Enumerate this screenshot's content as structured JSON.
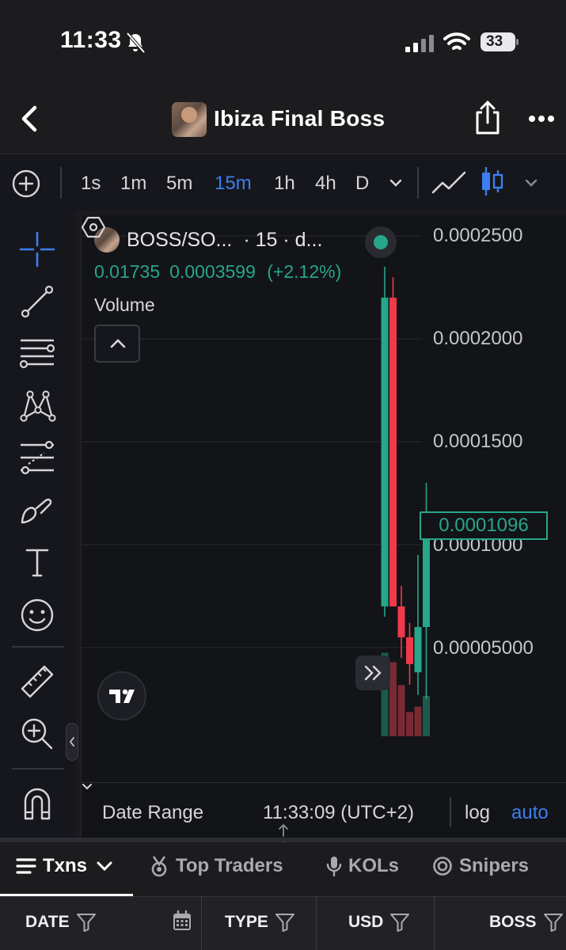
{
  "status_bar": {
    "time": "11:33",
    "battery": "33"
  },
  "header": {
    "title": "Ibiza Final Boss"
  },
  "timeframes": {
    "items": [
      "1s",
      "1m",
      "5m",
      "15m",
      "1h",
      "4h",
      "D"
    ],
    "active": "15m"
  },
  "chart": {
    "symbol": "BOSS/SO...",
    "interval": "· 15 · d...",
    "ohlc_change": "0.01735",
    "last_price": "0.0003599",
    "change_pct": "(+2.12%)",
    "volume_label": "Volume",
    "current_price_tag": "0.0001096",
    "date_range_label": "Date Range",
    "clock": "11:33:09 (UTC+2)",
    "log_label": "log",
    "auto_label": "auto",
    "colors": {
      "up": "#26a68a",
      "down": "#f0394a",
      "accent": "#3c7ef0"
    }
  },
  "chart_data": {
    "type": "candlestick",
    "y_ticks": [
      "0.0002500",
      "0.0002000",
      "0.0001500",
      "0.0001000",
      "0.00005000"
    ],
    "ylim": [
      0,
      0.00025
    ],
    "candles": [
      {
        "open": 7e-05,
        "high": 0.000235,
        "low": 6.5e-05,
        "close": 0.00022
      },
      {
        "open": 0.00022,
        "high": 0.00023,
        "low": 7e-05,
        "close": 7e-05
      },
      {
        "open": 7e-05,
        "high": 8e-05,
        "low": 4.5e-05,
        "close": 5.5e-05
      },
      {
        "open": 5.5e-05,
        "high": 6.2e-05,
        "low": 3.2e-05,
        "close": 4.2e-05
      },
      {
        "open": 3.8e-05,
        "high": 9.5e-05,
        "low": 2.7e-05,
        "close": 6e-05
      },
      {
        "open": 6e-05,
        "high": 0.00013,
        "low": 2.5e-05,
        "close": 0.0001096
      }
    ],
    "volume": [
      {
        "value": 0.62,
        "up": true
      },
      {
        "value": 0.55,
        "up": false
      },
      {
        "value": 0.38,
        "up": false
      },
      {
        "value": 0.18,
        "up": false
      },
      {
        "value": 0.22,
        "up": false
      },
      {
        "value": 0.3,
        "up": true
      }
    ]
  },
  "tabs": [
    {
      "label": "Txns",
      "icon": "list-icon",
      "active": true
    },
    {
      "label": "Top Traders",
      "icon": "medal-icon",
      "active": false
    },
    {
      "label": "KOLs",
      "icon": "microphone-icon",
      "active": false
    },
    {
      "label": "Snipers",
      "icon": "target-icon",
      "active": false
    }
  ],
  "table": {
    "columns": [
      "DATE",
      "TYPE",
      "USD",
      "BOSS"
    ]
  }
}
